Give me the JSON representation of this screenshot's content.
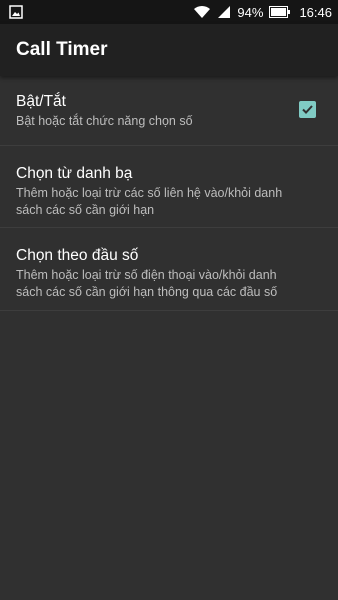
{
  "status_bar": {
    "battery": "94%",
    "time": "16:46",
    "icons": [
      "image-icon",
      "wifi-icon",
      "signal-icon",
      "battery-icon"
    ]
  },
  "toolbar": {
    "title": "Call Timer"
  },
  "preferences": [
    {
      "title": "Bật/Tắt",
      "summary": "Bật hoặc tắt chức năng chọn số",
      "checked": true
    },
    {
      "title": "Chọn từ danh bạ",
      "summary": "Thêm hoặc loại trừ các số liên hệ vào/khỏi danh sách các số cần giới hạn"
    },
    {
      "title": "Chọn theo đầu số",
      "summary": "Thêm hoặc loại trừ số điện thoại vào/khỏi danh sách các số cần giới hạn thông qua các đầu số"
    }
  ],
  "colors": {
    "background": "#303030",
    "toolbar": "#212121",
    "status_bar": "#151515",
    "accent": "#80cbc4"
  }
}
